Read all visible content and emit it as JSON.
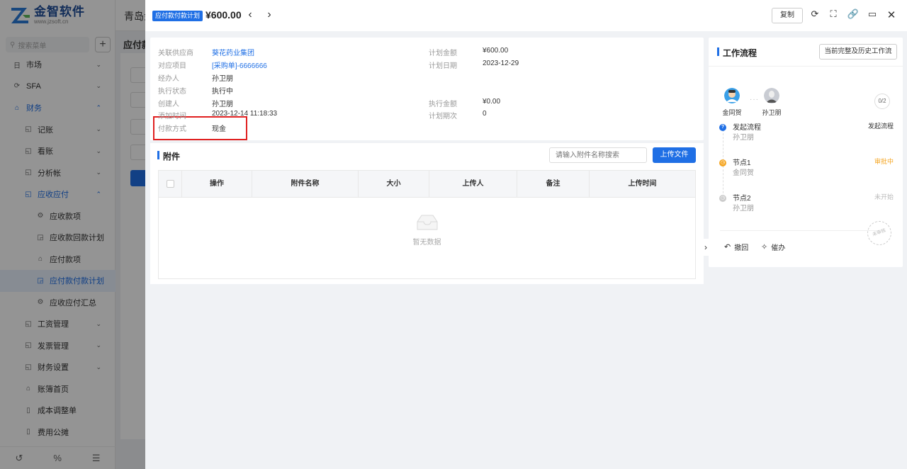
{
  "app": {
    "logo_name": "金智软件",
    "logo_url": "www.jzsoft.cn",
    "company": "青岛金",
    "page_title": "应付款"
  },
  "sidebar": {
    "search_placeholder": "搜索菜单",
    "plus": "+",
    "items": [
      {
        "label": "市场",
        "level": 1,
        "icon": "市场-icon",
        "glyph": "日",
        "chevron": "⌄"
      },
      {
        "label": "SFA",
        "level": 1,
        "icon": "sfa-icon",
        "glyph": "⟳",
        "chevron": "⌄"
      },
      {
        "label": "财务",
        "level": 1,
        "icon": "finance-icon",
        "glyph": "⌂",
        "chevron": "⌃"
      },
      {
        "label": "记账",
        "level": 2,
        "icon": "ledger-icon",
        "glyph": "◱",
        "chevron": "⌄"
      },
      {
        "label": "看账",
        "level": 2,
        "icon": "view-ledger-icon",
        "glyph": "◱",
        "chevron": "⌄"
      },
      {
        "label": "分析帐",
        "level": 2,
        "icon": "analysis-icon",
        "glyph": "◱",
        "chevron": "⌄"
      },
      {
        "label": "应收应付",
        "level": 2,
        "icon": "receivable-payable-icon",
        "glyph": "◱",
        "chevron": "⌃"
      },
      {
        "label": "应收款项",
        "level": 3,
        "icon": "gear-icon",
        "glyph": "⚙",
        "chevron": ""
      },
      {
        "label": "应收款回款计划",
        "level": 3,
        "icon": "plan-icon",
        "glyph": "◲",
        "chevron": ""
      },
      {
        "label": "应付款项",
        "level": 3,
        "icon": "home-icon",
        "glyph": "⌂",
        "chevron": ""
      },
      {
        "label": "应付款付款计划",
        "level": 3,
        "icon": "plan-icon",
        "glyph": "◲",
        "chevron": ""
      },
      {
        "label": "应收应付汇总",
        "level": 3,
        "icon": "gear-icon",
        "glyph": "⚙",
        "chevron": ""
      },
      {
        "label": "工资管理",
        "level": 2,
        "icon": "salary-icon",
        "glyph": "◱",
        "chevron": "⌄"
      },
      {
        "label": "发票管理",
        "level": 2,
        "icon": "invoice-icon",
        "glyph": "◱",
        "chevron": "⌄"
      },
      {
        "label": "财务设置",
        "level": 2,
        "icon": "finance-settings-icon",
        "glyph": "◱",
        "chevron": "⌄"
      },
      {
        "label": "账簿首页",
        "level": 2,
        "icon": "home-icon",
        "glyph": "⌂",
        "chevron": ""
      },
      {
        "label": "成本调整单",
        "level": 2,
        "icon": "document-icon",
        "glyph": "▯",
        "chevron": ""
      },
      {
        "label": "费用公摊",
        "level": 2,
        "icon": "document-icon",
        "glyph": "▯",
        "chevron": ""
      }
    ],
    "bottom_icons": [
      "history-icon",
      "percent-icon",
      "menu-collapse-icon"
    ]
  },
  "drawer": {
    "tag": "应付款付款计划",
    "amount": "¥600.00",
    "copy_label": "复制",
    "header_icons": [
      "refresh-icon",
      "fullscreen-icon",
      "link-icon",
      "monitor-icon",
      "close-icon"
    ]
  },
  "info": {
    "left": [
      {
        "label": "关联供应商",
        "value": "葵花药业集团",
        "link": true
      },
      {
        "label": "对应项目",
        "value": "[采购单]-6666666",
        "link": true
      },
      {
        "label": "经办人",
        "value": "孙卫朋",
        "link": false
      },
      {
        "label": "执行状态",
        "value": "执行中",
        "link": false
      },
      {
        "label": "创建人",
        "value": "孙卫朋",
        "link": false
      },
      {
        "label": "添加时间",
        "value": "2023-12-14 11:18:33",
        "link": false
      },
      {
        "label": "付款方式",
        "value": "现金",
        "link": false
      }
    ],
    "right": [
      {
        "label": "计划金额",
        "value": "¥600.00"
      },
      {
        "label": "计划日期",
        "value": "2023-12-29"
      },
      {
        "label": "执行金额",
        "value": "¥0.00"
      },
      {
        "label": "计划期次",
        "value": "0"
      }
    ]
  },
  "attachments": {
    "title": "附件",
    "search_placeholder": "请输入附件名称搜索",
    "upload_label": "上传文件",
    "columns": [
      "操作",
      "附件名称",
      "大小",
      "上传人",
      "备注",
      "上传时间"
    ],
    "rows": [],
    "empty_text": "暂无数据"
  },
  "workflow": {
    "title": "工作流程",
    "history_button": "当前完整及历史工作流",
    "participants": [
      "金同贺",
      "孙卫朋"
    ],
    "progress": "0/2",
    "nodes": [
      {
        "title": "发起流程",
        "person": "孙卫朋",
        "status": "发起流程",
        "status_color": "#333333",
        "dot_color": "#1f6fe5"
      },
      {
        "title": "节点1",
        "person": "金同贺",
        "status": "审批中",
        "status_color": "#f5a623",
        "dot_color": "#f5a623"
      },
      {
        "title": "节点2",
        "person": "孙卫朋",
        "status": "未开始",
        "status_color": "#bbbbbb",
        "dot_color": "#cccccc"
      }
    ],
    "actions": [
      {
        "label": "撤回",
        "icon": "undo-icon"
      },
      {
        "label": "催办",
        "icon": "pin-icon"
      }
    ],
    "stamp": "未审核"
  },
  "colors": {
    "primary": "#1f6fe5",
    "highlight": "#e02020",
    "pending": "#f5a623"
  }
}
